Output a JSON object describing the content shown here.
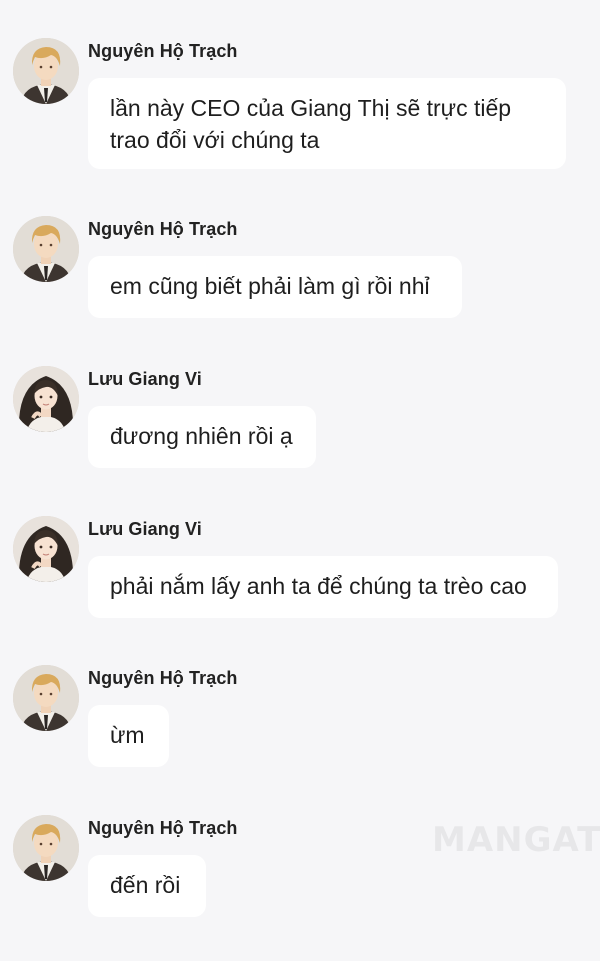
{
  "messages": [
    {
      "sender": "Nguyên Hộ Trạch",
      "avatar": "male-avatar",
      "text": "lần này CEO của Giang Thị sẽ trực tiếp trao đổi với chúng ta"
    },
    {
      "sender": "Nguyên Hộ Trạch",
      "avatar": "male-avatar",
      "text": "em cũng biết phải làm gì rồi nhỉ"
    },
    {
      "sender": "Lưu Giang Vi",
      "avatar": "female-avatar",
      "text": "đương nhiên rồi ạ"
    },
    {
      "sender": "Lưu Giang Vi",
      "avatar": "female-avatar",
      "text": "phải nắm lấy anh ta để chúng ta trèo cao"
    },
    {
      "sender": "Nguyên Hộ Trạch",
      "avatar": "male-avatar",
      "text": "ừm"
    },
    {
      "sender": "Nguyên Hộ Trạch",
      "avatar": "male-avatar",
      "text": "đến rồi"
    }
  ],
  "watermark": "MANGATOO"
}
